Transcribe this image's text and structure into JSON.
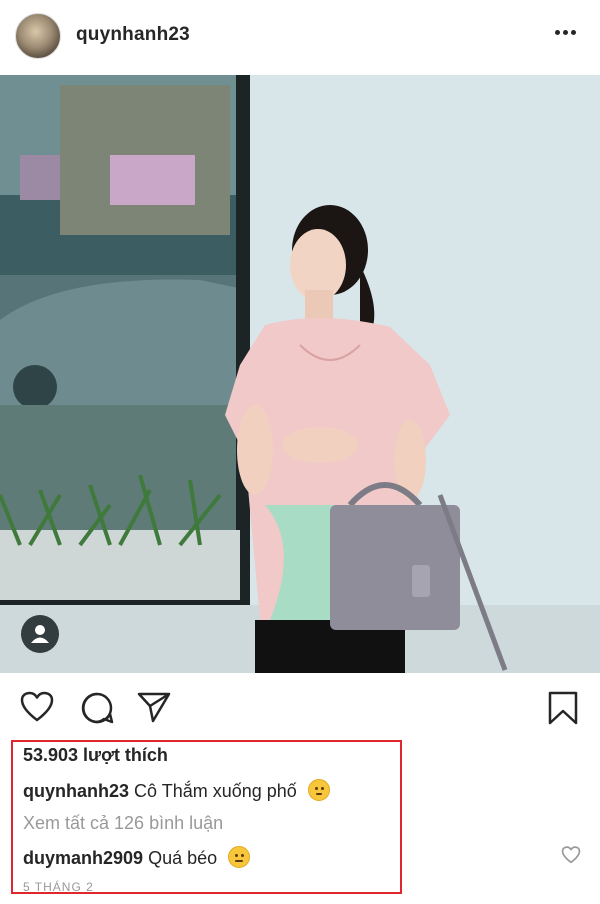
{
  "header": {
    "username": "quynhanh23",
    "avatar_icon": "profile-avatar",
    "more_icon": "more-options-icon"
  },
  "actions": {
    "like_icon": "heart-icon",
    "comment_icon": "comment-icon",
    "share_icon": "send-icon",
    "save_icon": "bookmark-icon"
  },
  "post": {
    "likes_text": "53.903 lượt thích",
    "caption_user": "quynhanh23",
    "caption_text": "Cô Thắm xuống phố",
    "view_all_comments": "Xem tất cả 126 bình luận",
    "comment_user": "duymanh2909",
    "comment_text": "Quá béo",
    "date": "5 THÁNG 2"
  },
  "colors": {
    "highlight": "#e0262f",
    "text": "#262626",
    "muted": "#999999"
  }
}
